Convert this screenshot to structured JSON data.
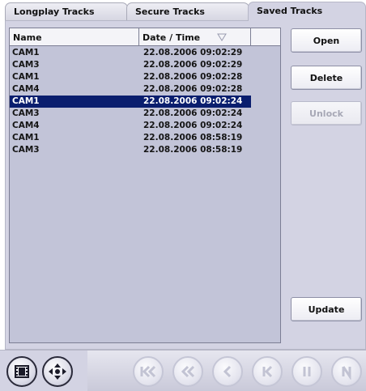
{
  "tabs": [
    {
      "label": "Longplay Tracks",
      "active": false
    },
    {
      "label": "Secure Tracks",
      "active": false
    },
    {
      "label": "Saved Tracks",
      "active": true
    }
  ],
  "list": {
    "columns": {
      "name": "Name",
      "datetime": "Date / Time"
    },
    "sort_icon": "sort-down-triangle-icon",
    "selected_index": 4,
    "rows": [
      {
        "name": "CAM1",
        "datetime": "22.08.2006 09:02:29"
      },
      {
        "name": "CAM3",
        "datetime": "22.08.2006 09:02:29"
      },
      {
        "name": "CAM1",
        "datetime": "22.08.2006 09:02:28"
      },
      {
        "name": "CAM4",
        "datetime": "22.08.2006 09:02:28"
      },
      {
        "name": "CAM1",
        "datetime": "22.08.2006 09:02:24"
      },
      {
        "name": "CAM3",
        "datetime": "22.08.2006 09:02:24"
      },
      {
        "name": "CAM4",
        "datetime": "22.08.2006 09:02:24"
      },
      {
        "name": "CAM1",
        "datetime": "22.08.2006 08:58:19"
      },
      {
        "name": "CAM3",
        "datetime": "22.08.2006 08:58:19"
      }
    ]
  },
  "buttons": {
    "open": "Open",
    "delete": "Delete",
    "unlock": "Unlock",
    "update": "Update"
  },
  "toolbar": {
    "icons": [
      "film-strip-icon",
      "pan-tilt-arrows-icon",
      "skip-to-start-icon",
      "rewind-icon",
      "step-back-icon",
      "previous-frame-icon",
      "pause-icon",
      "next-icon"
    ]
  },
  "colors": {
    "panel": "#d3d3e3",
    "list_bg": "#c2c4d8",
    "selection": "#0a1e6e",
    "disabled_text": "#a7a8b6"
  }
}
